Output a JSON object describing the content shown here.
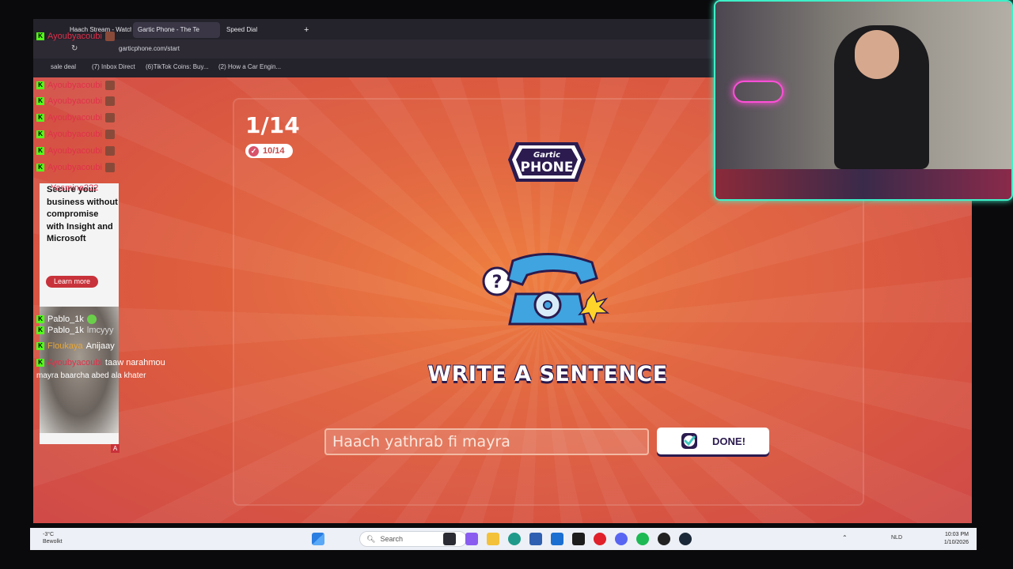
{
  "browser": {
    "tabs": [
      {
        "label": "Haach Stream - Watch L",
        "active": false
      },
      {
        "label": "Gartic Phone - The Te",
        "active": true
      },
      {
        "label": "Speed Dial",
        "active": false
      }
    ],
    "new_tab_label": "+",
    "url": "garticphone.com/start",
    "bookmarks": [
      "sale deal",
      "(7) Inbox Direct",
      "(6)TikTok Coins: Buy...",
      "(2) How a Car Engin..."
    ]
  },
  "game": {
    "round": "1/14",
    "done_count": "10/14",
    "logo_top": "Gartic",
    "logo_main": "PHONE",
    "prompt": "WRITE A SENTENCE",
    "input_value": "Haach yathrab fi mayra",
    "done_label": "DONE!",
    "colors": {
      "accent": "#2b1b4f",
      "background": "#e0603c",
      "teal": "#3ec9c0"
    }
  },
  "chat": {
    "messages": [
      {
        "user": "Ayoubyacoubi",
        "text": ""
      },
      {
        "user": "Ayoubyacoubi",
        "text": ""
      },
      {
        "user": "Ayoubyacoubi",
        "text": ""
      },
      {
        "user": "Ayoubyacoubi",
        "text": ""
      },
      {
        "user": "Ayoubyacoubi",
        "text": ""
      },
      {
        "user": "Ayoubyacoubi",
        "text": ""
      },
      {
        "user": "Ayoubyacoubi",
        "text": ""
      },
      {
        "user": "Yasmine222",
        "text": ""
      },
      {
        "user": "Yasmine222",
        "text": ""
      },
      {
        "user": "Yasmine222",
        "text": ""
      },
      {
        "user": "Pablo_1k",
        "text": ""
      },
      {
        "user": "Pablo_1k",
        "text": ""
      },
      {
        "user": "Pablo_1k",
        "text": ""
      },
      {
        "user": "Pablo_1k",
        "text": ""
      },
      {
        "user": "Pablo_1k",
        "text": "lmcyyy"
      },
      {
        "user": "Floukaya",
        "text": "Anijaay"
      },
      {
        "user": "Ayoubyacoubi",
        "text": "taaw narahmou"
      }
    ],
    "continuation": "mayra baarcha abed ala khater"
  },
  "ad": {
    "text": "Secure your business without compromise with Insight and Microsoft",
    "label": "Learn more",
    "badge": "A"
  },
  "taskbar": {
    "weather_temp": "-3°C",
    "weather_desc": "Bewolkt",
    "search_placeholder": "Search",
    "language": "NLD",
    "time": "10:03 PM",
    "date": "1/10/2026"
  }
}
